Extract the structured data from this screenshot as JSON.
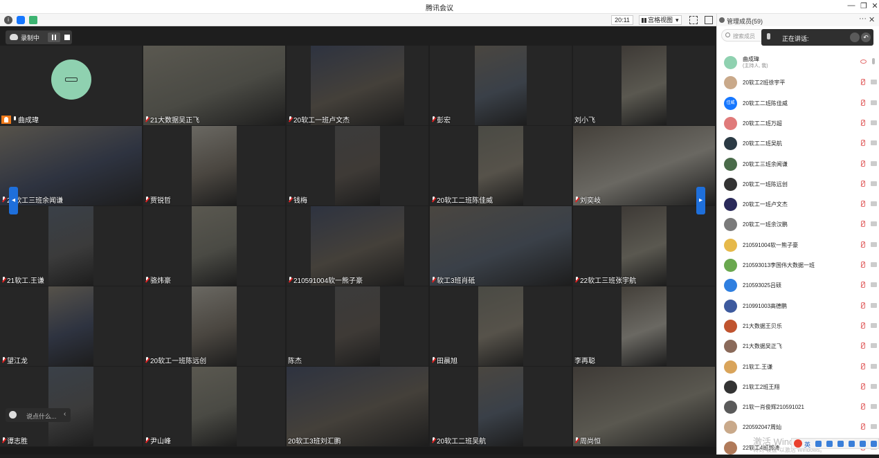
{
  "window": {
    "title": "腾讯会议",
    "minimize": "—",
    "restore": "❐",
    "close": "✕"
  },
  "topbar": {
    "time": "20:11",
    "view_label": "宫格视图",
    "view_caret": "▾"
  },
  "recording": {
    "label": "录制中"
  },
  "grid": {
    "tiles": [
      {
        "name": "曲成瑋",
        "muted": false,
        "host": true
      },
      {
        "name": "21大数据吴正飞",
        "muted": true
      },
      {
        "name": "20软工一班卢文杰",
        "muted": true
      },
      {
        "name": "彭宏",
        "muted": true
      },
      {
        "name": "刘小飞",
        "muted": false,
        "nomic": true
      },
      {
        "name": "20软工三班余闻谦",
        "muted": true
      },
      {
        "name": "贾锐哲",
        "muted": true
      },
      {
        "name": "钱梅",
        "muted": true
      },
      {
        "name": "20软工二班陈佳威",
        "muted": true
      },
      {
        "name": "刘奕岐",
        "muted": true
      },
      {
        "name": "21软工.王谦",
        "muted": true
      },
      {
        "name": "骆炜豪",
        "muted": true
      },
      {
        "name": "210591004软一熊子豪",
        "muted": true
      },
      {
        "name": "软工3班肖砥",
        "muted": true
      },
      {
        "name": "22软工三班张宇航",
        "muted": true
      },
      {
        "name": "望江龙",
        "muted": true
      },
      {
        "name": "20软工一班陈远创",
        "muted": true
      },
      {
        "name": "陈杰",
        "muted": false,
        "nomic": true
      },
      {
        "name": "田晨旭",
        "muted": true
      },
      {
        "name": "李再聪",
        "muted": false,
        "nomic": true
      },
      {
        "name": "谭志胜",
        "muted": true
      },
      {
        "name": "尹山峰",
        "muted": true
      },
      {
        "name": "20软工3班刘汇鹏",
        "muted": false,
        "nomic": true
      },
      {
        "name": "20软工二班吴航",
        "muted": true
      },
      {
        "name": "周尚恒",
        "muted": true
      }
    ]
  },
  "nav": {
    "left": "◂",
    "right": "▸"
  },
  "chat": {
    "placeholder": "说点什么...",
    "chevron": "‹"
  },
  "panel": {
    "title": "管理成员(59)",
    "more": "···",
    "close": "✕",
    "search_placeholder": "搜索成员",
    "speaking_label": "正在讲话:",
    "speaking_close": "↶",
    "members": [
      {
        "name": "曲成瑋",
        "sub": "(主持人, 我)",
        "avatar_color": "#8fd1b0",
        "self": true
      },
      {
        "name": "20软工2班徐宇平",
        "avatar_color": "#c9a98a"
      },
      {
        "name": "20软工二班陈佳威",
        "avatar_color": "#1677ff",
        "avatar_text": "佳威"
      },
      {
        "name": "20软工二班万超",
        "avatar_color": "#e07a7a"
      },
      {
        "name": "20软工二班吴航",
        "avatar_color": "#2b3a44"
      },
      {
        "name": "20软工三班余闻谦",
        "avatar_color": "#4a6b4a"
      },
      {
        "name": "20软工一班陈远创",
        "avatar_color": "#333333"
      },
      {
        "name": "20软工一班卢文杰",
        "avatar_color": "#2a2a5a"
      },
      {
        "name": "20软工一班余汉鹏",
        "avatar_color": "#7a7a7a"
      },
      {
        "name": "210591004软一熊子豪",
        "avatar_color": "#e6b94a"
      },
      {
        "name": "210593013李国伟大数据一班",
        "avatar_color": "#6aa84f"
      },
      {
        "name": "210593025吕硕",
        "avatar_color": "#2f7fe0"
      },
      {
        "name": "210991003高德鹏",
        "avatar_color": "#3d5a9e"
      },
      {
        "name": "21大数据王贝乐",
        "avatar_color": "#c0542f"
      },
      {
        "name": "21大数据吴正飞",
        "avatar_color": "#8a6a5a"
      },
      {
        "name": "21软工.王谦",
        "avatar_color": "#d9a45a"
      },
      {
        "name": "21软工2班王翔",
        "avatar_color": "#333333"
      },
      {
        "name": "21软一肖俊辉210591021",
        "avatar_color": "#5a5a5a"
      },
      {
        "name": "220592047周灿",
        "avatar_color": "#c9a98a"
      },
      {
        "name": "22软工4班郭涛",
        "avatar_color": "#b07a5a"
      }
    ]
  },
  "os": {
    "watermark": "激活 Windows",
    "watermark_sub": "转到\"设置\"以激活 Windows。",
    "ime_label": "英"
  },
  "colors": {
    "accent": "#1e6fdb",
    "host_badge": "#f07a1a",
    "muted_red": "#e02020"
  }
}
